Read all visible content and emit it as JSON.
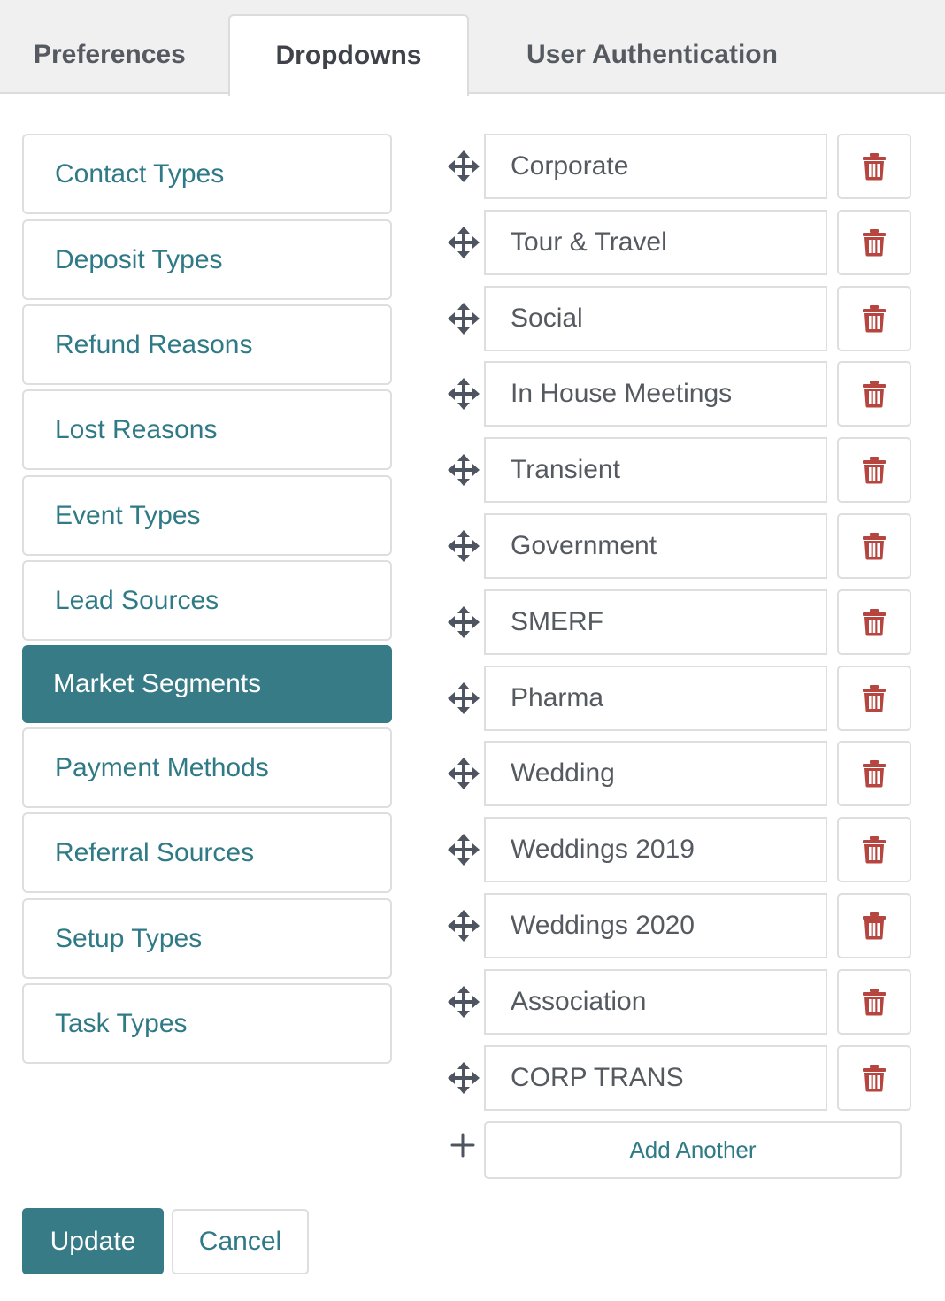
{
  "tabs": [
    {
      "label": "Preferences",
      "active": false
    },
    {
      "label": "Dropdowns",
      "active": true
    },
    {
      "label": "User Authentication",
      "active": false
    }
  ],
  "categories": [
    {
      "label": "Contact Types"
    },
    {
      "label": "Deposit Types"
    },
    {
      "label": "Refund Reasons"
    },
    {
      "label": "Lost Reasons"
    },
    {
      "label": "Event Types"
    },
    {
      "label": "Lead Sources"
    },
    {
      "label": "Market Segments",
      "active": true
    },
    {
      "label": "Payment Methods"
    },
    {
      "label": "Referral Sources"
    },
    {
      "label": "Setup Types"
    },
    {
      "label": "Task Types"
    }
  ],
  "options": [
    {
      "value": "Corporate"
    },
    {
      "value": "Tour & Travel"
    },
    {
      "value": "Social"
    },
    {
      "value": "In House Meetings"
    },
    {
      "value": "Transient"
    },
    {
      "value": "Government"
    },
    {
      "value": "SMERF"
    },
    {
      "value": "Pharma"
    },
    {
      "value": "Wedding"
    },
    {
      "value": "Weddings 2019"
    },
    {
      "value": "Weddings 2020"
    },
    {
      "value": "Association"
    },
    {
      "value": "CORP TRANS"
    }
  ],
  "actions": {
    "add_label": "Add Another",
    "update_label": "Update",
    "cancel_label": "Cancel"
  },
  "icons": {
    "row_handle": "move-icon",
    "row_delete": "trash-icon",
    "add": "plus-icon"
  },
  "colors": {
    "accent": "#377b87",
    "link_text": "#2f7a86",
    "delete_icon": "#b5453e"
  }
}
